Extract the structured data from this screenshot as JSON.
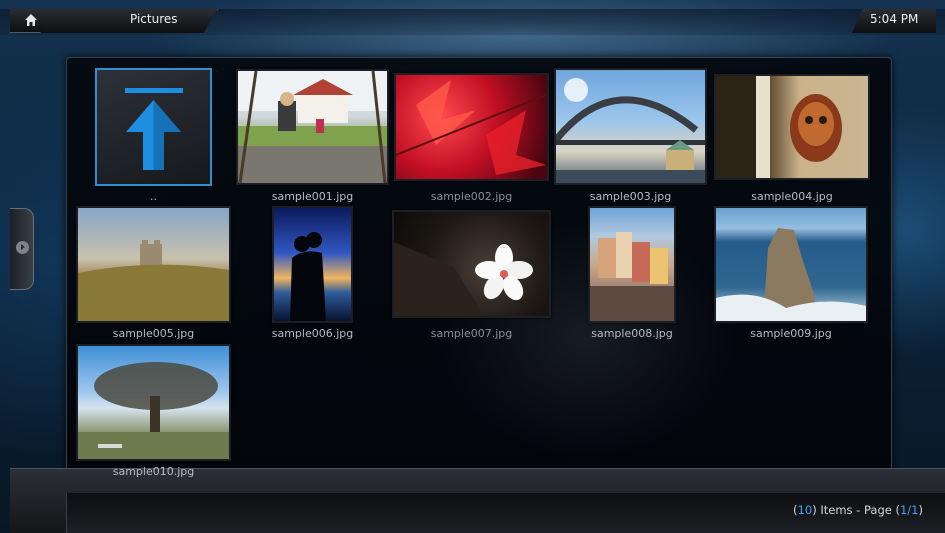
{
  "window": {
    "title": "Pictures",
    "clock": "5:04 PM"
  },
  "nav": {
    "home_icon": "home-icon",
    "side_handle_icon": "chevron-right-icon"
  },
  "grid": {
    "parent_label": "..",
    "items": [
      {
        "label": "sample001.jpg",
        "icon": "photo-swing"
      },
      {
        "label": "sample002.jpg",
        "icon": "photo-red-leaves"
      },
      {
        "label": "sample003.jpg",
        "icon": "photo-bridge"
      },
      {
        "label": "sample004.jpg",
        "icon": "photo-mask"
      },
      {
        "label": "sample005.jpg",
        "icon": "photo-tower"
      },
      {
        "label": "sample006.jpg",
        "icon": "photo-silhouette"
      },
      {
        "label": "sample007.jpg",
        "icon": "photo-flower"
      },
      {
        "label": "sample008.jpg",
        "icon": "photo-town"
      },
      {
        "label": "sample009.jpg",
        "icon": "photo-sea-rock"
      },
      {
        "label": "sample010.jpg",
        "icon": "photo-tree"
      }
    ]
  },
  "status": {
    "count": "10",
    "items_text": "Items - Page",
    "page": "1/1"
  },
  "colors": {
    "accent": "#3da2ff",
    "selection_border": "#2f8fd0"
  }
}
